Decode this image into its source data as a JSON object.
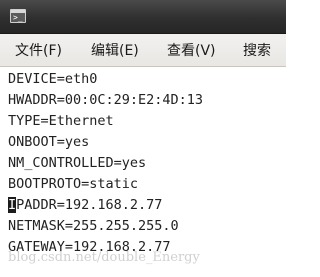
{
  "titlebar": {
    "icon": "terminal-icon",
    "title": ""
  },
  "menu": {
    "file": "文件(F)",
    "edit": "编辑(E)",
    "view": "查看(V)",
    "search": "搜索"
  },
  "editor": {
    "lines": [
      "DEVICE=eth0",
      "HWADDR=00:0C:29:E2:4D:13",
      "TYPE=Ethernet",
      "ONBOOT=yes",
      "NM_CONTROLLED=yes",
      "BOOTPROTO=static",
      "IPADDR=192.168.2.77",
      "NETMASK=255.255.255.0",
      "GATEWAY=192.168.2.77"
    ],
    "cursor_line_first_char": "I",
    "cursor_line_rest": "PADDR=192.168.2.77"
  },
  "watermark": "blog.csdn.net/double_Energy"
}
